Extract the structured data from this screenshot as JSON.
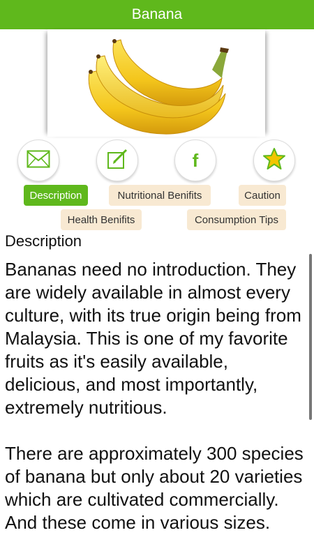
{
  "header": {
    "title": "Banana"
  },
  "icons": [
    {
      "name": "mail-icon"
    },
    {
      "name": "edit-icon"
    },
    {
      "name": "facebook-icon"
    },
    {
      "name": "star-icon"
    }
  ],
  "tabs": {
    "description": "Description",
    "nutritional": "Nutritional Benifits",
    "caution": "Caution",
    "health": "Health Benifits",
    "consumption": "Consumption Tips"
  },
  "active_tab": "Description",
  "content": {
    "title": "Description",
    "paragraphs": [
      "Bananas need no introduction. They are widely available in almost every culture, with its true origin being from Malaysia. This is one of my favorite fruits as it's easily available, delicious, and most importantly, extremely nutritious.",
      "There are approximately 300 species of banana but only about 20 varieties which are cultivated commercially. And these come in various sizes."
    ]
  },
  "colors": {
    "accent": "#5fb81c",
    "tab_inactive": "#f8e9d2",
    "star_fill": "#f2c500"
  }
}
